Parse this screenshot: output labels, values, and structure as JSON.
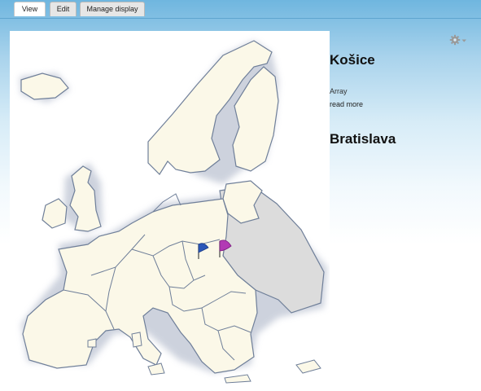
{
  "tabs": [
    {
      "label": "View"
    },
    {
      "label": "Edit"
    },
    {
      "label": "Manage display"
    }
  ],
  "icons": {
    "settings": "gear-icon",
    "dropdown": "chevron-down-icon"
  },
  "map": {
    "markers": [
      {
        "color": "#2a56b8",
        "name": "blue-flag"
      },
      {
        "color": "#b23ab4",
        "name": "purple-flag"
      }
    ],
    "colors": {
      "land": "#fbf8e8",
      "outside": "#dcdcdc",
      "border": "#6f7f99",
      "halo": "#c2c8d6"
    }
  },
  "content": {
    "items": [
      {
        "title": "Košice",
        "body": "Array",
        "read_more": "read more"
      },
      {
        "title": "Bratislava"
      }
    ]
  }
}
